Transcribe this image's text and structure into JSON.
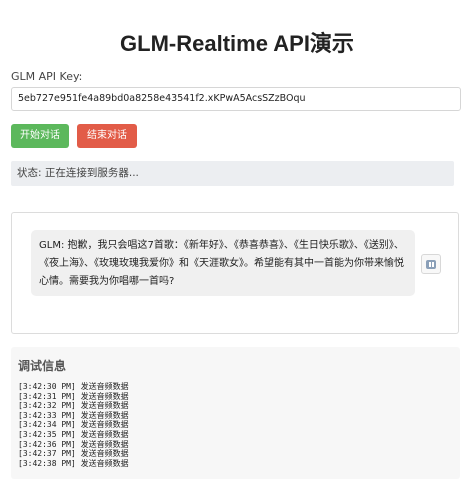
{
  "page": {
    "title": "GLM-Realtime API演示"
  },
  "api_key": {
    "label": "GLM API Key:",
    "value": "5eb727e951fe4a89bd0a8258e43541f2.xKPwA5AcsSZzBOqu"
  },
  "controls": {
    "start_label": "开始对话",
    "end_label": "结束对话",
    "start_color": "#5cb85c",
    "end_color": "#e25c48"
  },
  "status": {
    "text": "状态: 正在连接到服务器..."
  },
  "chat": {
    "messages": [
      {
        "text": "GLM: 抱歉，我只会唱这7首歌：《新年好》、《恭喜恭喜》、《生日快乐歌》、《送别》、《夜上海》、《玫瑰玫瑰我爱你》和《天涯歌女》。希望能有其中一首能为你带来愉悦心情。需要我为你唱哪一首吗?",
        "action_icon": "pause-icon"
      }
    ]
  },
  "debug": {
    "title": "调试信息",
    "logs": [
      "[3:42:30 PM] 发送音频数据",
      "[3:42:31 PM] 发送音频数据",
      "[3:42:32 PM] 发送音频数据",
      "[3:42:33 PM] 发送音频数据",
      "[3:42:34 PM] 发送音频数据",
      "[3:42:35 PM] 发送音频数据",
      "[3:42:36 PM] 发送音频数据",
      "[3:42:37 PM] 发送音频数据",
      "[3:42:38 PM] 发送音频数据"
    ]
  }
}
